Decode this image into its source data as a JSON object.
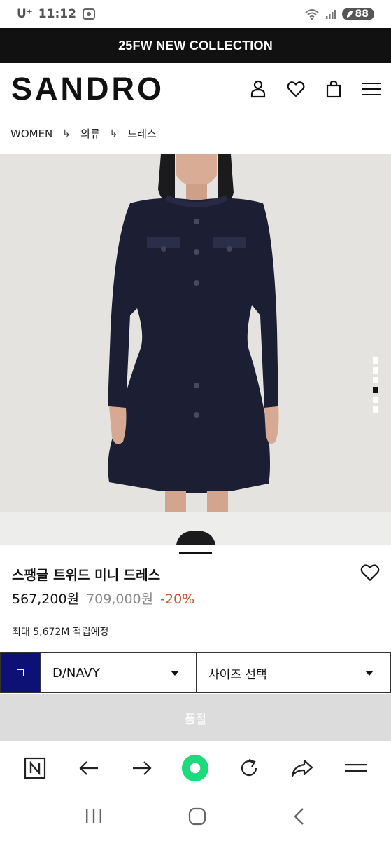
{
  "status_bar": {
    "carrier": "U⁺",
    "time": "11:12",
    "battery": "88"
  },
  "announcement": "25FW NEW COLLECTION",
  "header": {
    "logo": "SANDRO",
    "icons": [
      "user-icon",
      "heart-icon",
      "bag-icon",
      "menu-icon"
    ]
  },
  "breadcrumb": {
    "items": [
      "WOMEN",
      "의류",
      "드레스"
    ],
    "separator": "↳"
  },
  "product": {
    "name": "스팽글 트위드 미니 드레스",
    "price": "567,200원",
    "original_price": "709,000원",
    "discount": "-20%",
    "points": "최대 5,672M 적립예정",
    "image_count": 6,
    "active_image": 4
  },
  "options": {
    "color_value": "D/NAVY",
    "color_swatch": "#0d1175",
    "size_placeholder": "사이즈 선택"
  },
  "cta": {
    "label": "품절"
  },
  "colors": {
    "accent_discount": "#c0562b",
    "browser_accent": "#1bdb7c"
  }
}
